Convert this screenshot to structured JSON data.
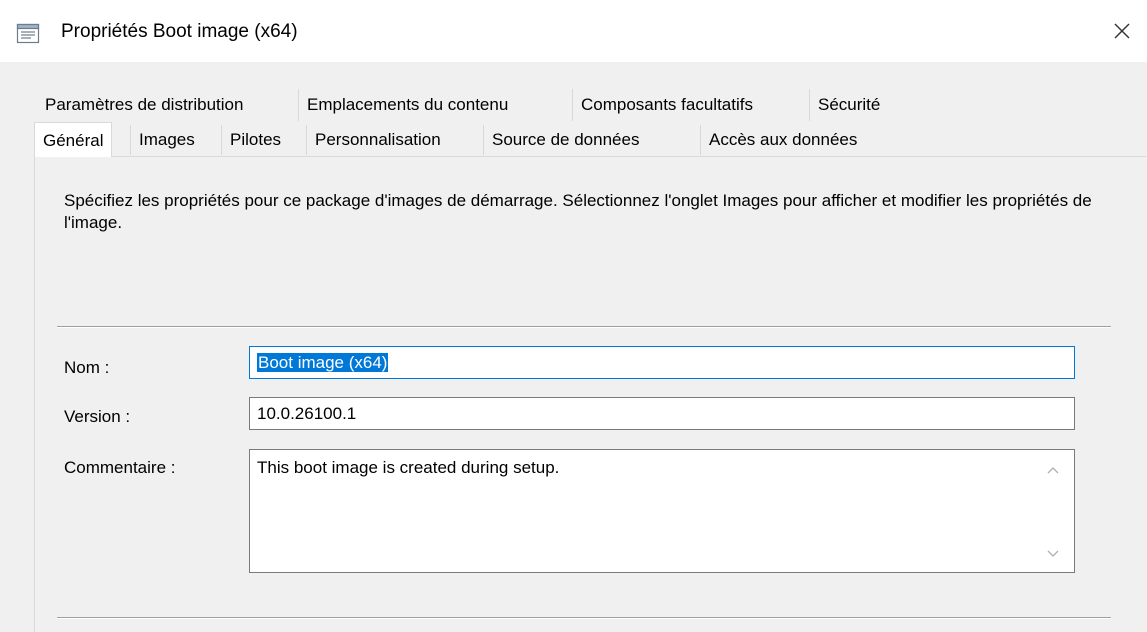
{
  "window": {
    "title": "Propriétés Boot image (x64)",
    "icon": "properties-window-icon",
    "close_glyph": "✕"
  },
  "tabs": {
    "row1": [
      "Paramètres de distribution",
      "Emplacements du contenu",
      "Composants facultatifs",
      "Sécurité"
    ],
    "row2": [
      "Général",
      "Images",
      "Pilotes",
      "Personnalisation",
      "Source de données",
      "Accès aux données"
    ],
    "active": "Général"
  },
  "general": {
    "description": "Spécifiez les propriétés pour ce package d'images de démarrage. Sélectionnez l'onglet Images pour afficher et modifier les propriétés de l'image.",
    "name_label": "Nom :",
    "name_value": "Boot image (x64)",
    "version_label": "Version :",
    "version_value": "10.0.26100.1",
    "comment_label": "Commentaire :",
    "comment_value": "This boot image is created during setup."
  },
  "colors": {
    "accent": "#0078d7",
    "dialog_bg": "#f0f0f0"
  }
}
